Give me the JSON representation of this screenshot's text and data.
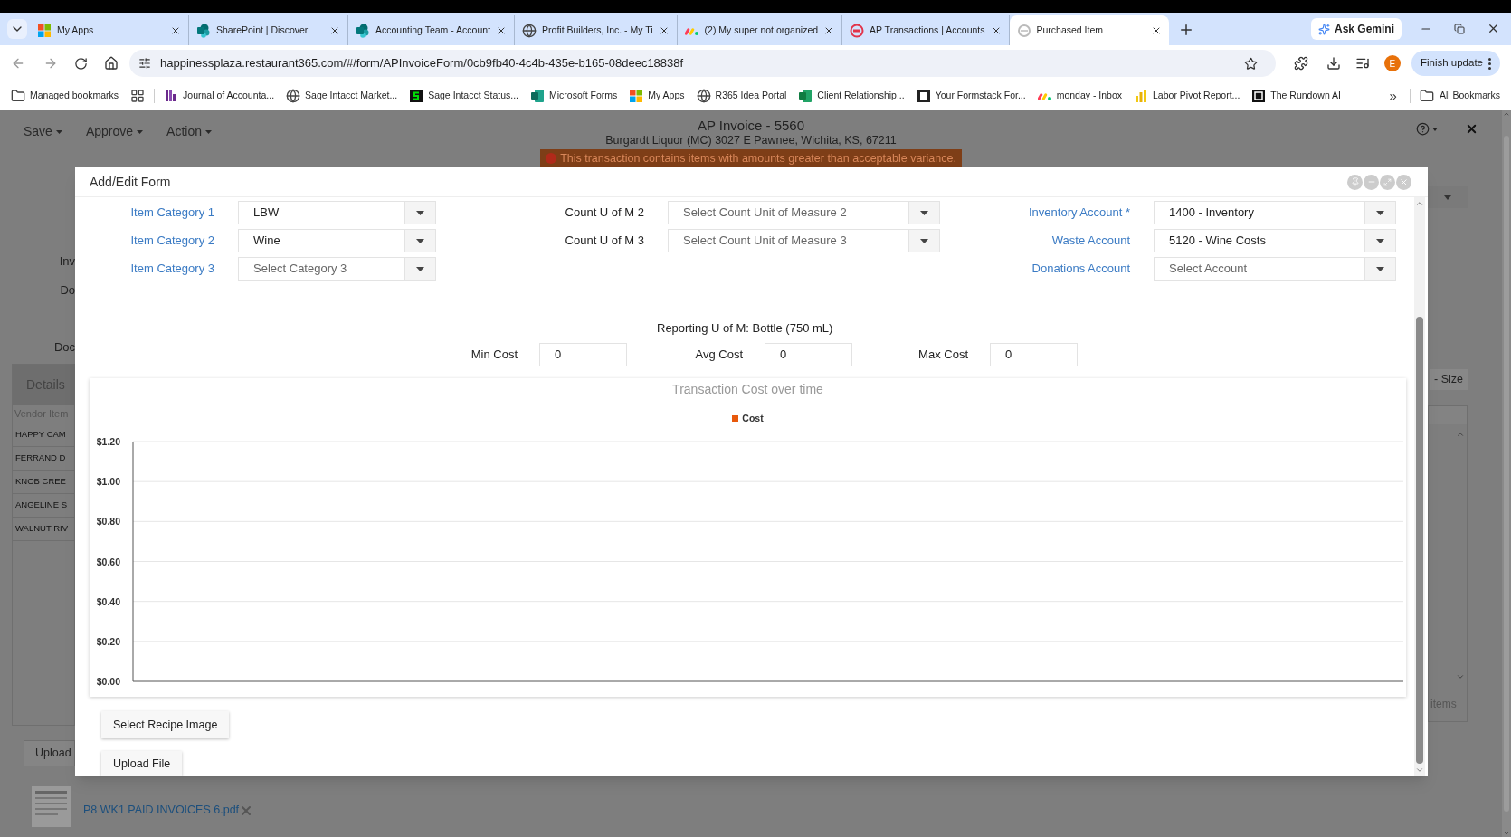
{
  "browser": {
    "tabs": [
      {
        "title": "My Apps",
        "kind": "windows",
        "selected": false
      },
      {
        "title": "SharePoint | Discover",
        "kind": "sharepoint",
        "selected": false
      },
      {
        "title": "Accounting Team - Account",
        "kind": "sharepoint",
        "selected": false
      },
      {
        "title": "Profit Builders, Inc. - My Ti",
        "kind": "globe",
        "selected": false
      },
      {
        "title": "(2) My super not organized",
        "kind": "monday",
        "selected": false
      },
      {
        "title": "AP Transactions | Accounts",
        "kind": "r365",
        "selected": false
      },
      {
        "title": "Purchased Item",
        "kind": "blank",
        "selected": true
      }
    ],
    "ask_button": "Ask Gemini",
    "url": "happinessplaza.restaurant365.com/#/form/APInvoiceForm/0cb9fb40-4c4b-435e-b165-08deec18838f",
    "profile_initial": "E",
    "update_button": "Finish update",
    "bookmarks": [
      {
        "label": "Managed bookmarks",
        "kind": "folder"
      },
      {
        "kind": "apps"
      },
      {
        "label": "Journal of Accounta...",
        "kind": "journal"
      },
      {
        "label": "Sage Intacct Market...",
        "kind": "globe"
      },
      {
        "label": "Sage Intacct Status...",
        "kind": "sage"
      },
      {
        "label": "Microsoft Forms",
        "kind": "forms"
      },
      {
        "label": "My Apps",
        "kind": "windows"
      },
      {
        "label": "R365 Idea Portal",
        "kind": "globe"
      },
      {
        "label": "Client Relationship...",
        "kind": "sheet"
      },
      {
        "label": "Your Formstack For...",
        "kind": "formstack"
      },
      {
        "label": "monday - Inbox",
        "kind": "monday"
      },
      {
        "label": "Labor Pivot Report...",
        "kind": "chart"
      },
      {
        "label": "The Rundown AI",
        "kind": "rundown"
      }
    ],
    "more_bookmarks": "»",
    "all_bookmarks": "All Bookmarks"
  },
  "page": {
    "menus": [
      "Save",
      "Approve",
      "Action"
    ],
    "title": "AP Invoice - 5560",
    "subtitle": "Burgardt Liquor (MC) 3027 E Pawnee, Wichita, KS, 67211",
    "warning": "This transaction contains items with amounts greater than acceptable variance.",
    "left_labels": [
      "Inv",
      "Do",
      "Doc"
    ],
    "details_tab": "Details",
    "table_header": "Vendor Item",
    "rows": [
      "HAPPY CAM",
      "FERRAND D",
      "KNOB CREE",
      "ANGELINE S",
      "WALNUT RIV"
    ],
    "upload_button": "Upload",
    "attachment": "P8 WK1 PAID INVOICES 6.pdf",
    "size_button": "- Size",
    "items_label": "items"
  },
  "modal": {
    "title": "Add/Edit Form",
    "field_columns": [
      [
        {
          "label": "Item Category 1",
          "linked": true,
          "value": "LBW"
        },
        {
          "label": "Item Category 2",
          "linked": true,
          "value": "Wine"
        },
        {
          "label": "Item Category 3",
          "linked": true,
          "placeholder": "Select Category 3"
        }
      ],
      [
        {
          "label": "Count U of M 2",
          "linked": false,
          "placeholder": "Select Count Unit of Measure 2"
        },
        {
          "label": "Count U of M 3",
          "linked": false,
          "placeholder": "Select Count Unit of Measure 3"
        }
      ],
      [
        {
          "label": "Inventory Account *",
          "linked": true,
          "value": "1400 - Inventory"
        },
        {
          "label": "Waste Account",
          "linked": true,
          "value": "5120 - Wine Costs"
        },
        {
          "label": "Donations Account",
          "linked": true,
          "placeholder": "Select Account"
        }
      ]
    ],
    "reporting_uom": "Reporting U of M: Bottle (750 mL)",
    "cost_fields": [
      {
        "label": "Min Cost",
        "value": "0"
      },
      {
        "label": "Avg Cost",
        "value": "0"
      },
      {
        "label": "Max Cost",
        "value": "0"
      }
    ],
    "chart": {
      "chart_data": {
        "type": "line",
        "title": "Transaction Cost over time",
        "ylim": [
          0,
          1.2
        ],
        "grid": true,
        "yticks": [
          {
            "value": 0,
            "label": "$0.00"
          },
          {
            "value": 0.2,
            "label": "$0.20"
          },
          {
            "value": 0.4,
            "label": "$0.40"
          },
          {
            "value": 0.6,
            "label": "$0.60"
          },
          {
            "value": 0.8,
            "label": "$0.80"
          },
          {
            "value": 1,
            "label": "$1.00"
          },
          {
            "value": 1.2,
            "label": "$1.20"
          }
        ],
        "series": [
          {
            "name": "Cost",
            "color": "#e8590c"
          }
        ]
      }
    },
    "buttons": [
      "Select Recipe Image",
      "Upload File"
    ]
  }
}
